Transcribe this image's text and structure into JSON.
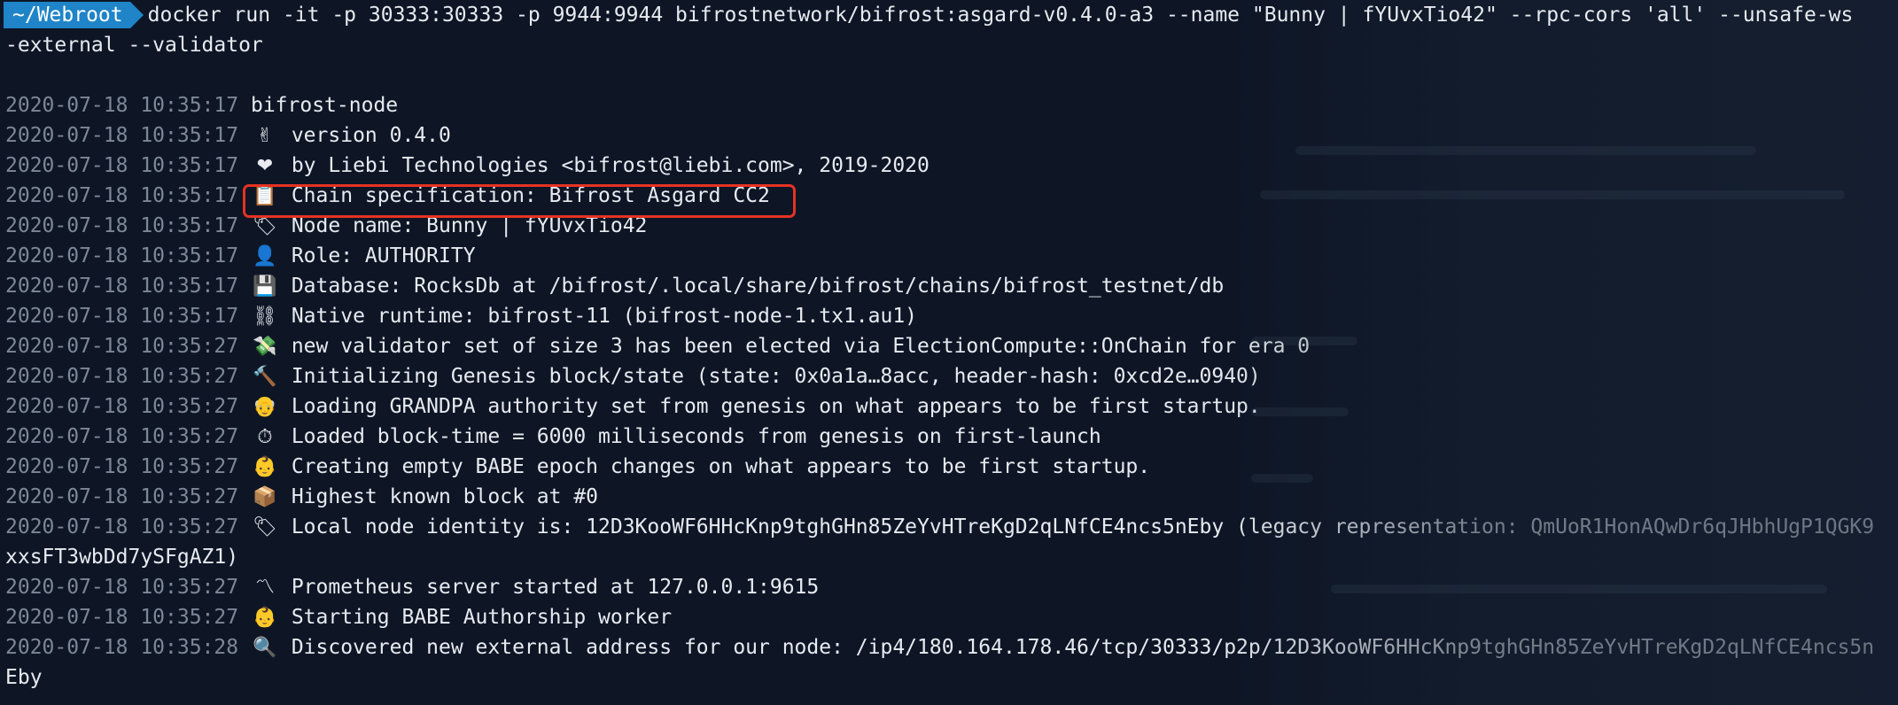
{
  "prompt": {
    "path": "~/Webroot",
    "command_line1": "docker run -it -p 30333:30333 -p 9944:9944 bifrostnetwork/bifrost:asgard-v0.4.0-a3 --name \"Bunny | fYUvxTio42\" --rpc-cors 'all' --unsafe-ws",
    "command_line2": "-external --validator"
  },
  "logs": [
    {
      "ts": "2020-07-18 10:35:17",
      "icon": "",
      "icon_name": "none",
      "msg": "bifrost-node"
    },
    {
      "ts": "2020-07-18 10:35:17",
      "icon": "✌",
      "icon_name": "victory-hand-icon",
      "msg": "version 0.4.0"
    },
    {
      "ts": "2020-07-18 10:35:17",
      "icon": "❤",
      "icon_name": "heart-icon",
      "msg": "by Liebi Technologies <bifrost@liebi.com>, 2019-2020"
    },
    {
      "ts": "2020-07-18 10:35:17",
      "icon": "📋",
      "icon_name": "clipboard-icon",
      "msg": "Chain specification: Bifrost Asgard CC2"
    },
    {
      "ts": "2020-07-18 10:35:17",
      "icon": "🏷",
      "icon_name": "label-tag-icon",
      "msg": "Node name: Bunny | fYUvxTio42"
    },
    {
      "ts": "2020-07-18 10:35:17",
      "icon": "👤",
      "icon_name": "person-icon",
      "msg": "Role: AUTHORITY"
    },
    {
      "ts": "2020-07-18 10:35:17",
      "icon": "💾",
      "icon_name": "floppy-disk-icon",
      "msg": "Database: RocksDb at /bifrost/.local/share/bifrost/chains/bifrost_testnet/db"
    },
    {
      "ts": "2020-07-18 10:35:17",
      "icon": "⛓",
      "icon_name": "chains-icon",
      "msg": "Native runtime: bifrost-11 (bifrost-node-1.tx1.au1)"
    },
    {
      "ts": "2020-07-18 10:35:27",
      "icon": "💸",
      "icon_name": "money-wings-icon",
      "msg": "new validator set of size 3 has been elected via ElectionCompute::OnChain for era 0"
    },
    {
      "ts": "2020-07-18 10:35:27",
      "icon": "🔨",
      "icon_name": "hammer-icon",
      "msg": "Initializing Genesis block/state (state: 0x0a1a…8acc, header-hash: 0xcd2e…0940)"
    },
    {
      "ts": "2020-07-18 10:35:27",
      "icon": "👴",
      "icon_name": "old-man-icon",
      "msg": "Loading GRANDPA authority set from genesis on what appears to be first startup."
    },
    {
      "ts": "2020-07-18 10:35:27",
      "icon": "⏱",
      "icon_name": "stopwatch-icon",
      "msg": "Loaded block-time = 6000 milliseconds from genesis on first-launch"
    },
    {
      "ts": "2020-07-18 10:35:27",
      "icon": "👶",
      "icon_name": "baby-icon",
      "msg": "Creating empty BABE epoch changes on what appears to be first startup."
    },
    {
      "ts": "2020-07-18 10:35:27",
      "icon": "📦",
      "icon_name": "package-icon",
      "msg": "Highest known block at #0"
    },
    {
      "ts": "2020-07-18 10:35:27",
      "icon": "🏷",
      "icon_name": "label-tag-icon",
      "msg": "Local node identity is: 12D3KooWF6HHcKnp9tghGHn85ZeYvHTreKgD2qLNfCE4ncs5nEby (legacy representation: QmUoR1HonAQwDr6qJHbhUgP1QGK9",
      "cont": "xxsFT3wbDd7ySFgAZ1)"
    },
    {
      "ts": "2020-07-18 10:35:27",
      "icon": "〽",
      "icon_name": "part-alternation-mark-icon",
      "msg": "Prometheus server started at 127.0.0.1:9615"
    },
    {
      "ts": "2020-07-18 10:35:27",
      "icon": "👶",
      "icon_name": "baby-icon",
      "msg": "Starting BABE Authorship worker"
    },
    {
      "ts": "2020-07-18 10:35:28",
      "icon": "🔍",
      "icon_name": "magnifier-icon",
      "msg": "Discovered new external address for our node: /ip4/180.164.178.46/tcp/30333/p2p/12D3KooWF6HHcKnp9tghGHn85ZeYvHTreKgD2qLNfCE4ncs5n",
      "cont": "Eby"
    }
  ],
  "colors": {
    "background": "#0e1626",
    "prompt_bg": "#1f84c8",
    "timestamp": "#7c8797",
    "text": "#e7ebf0",
    "highlight": "#e63223"
  }
}
